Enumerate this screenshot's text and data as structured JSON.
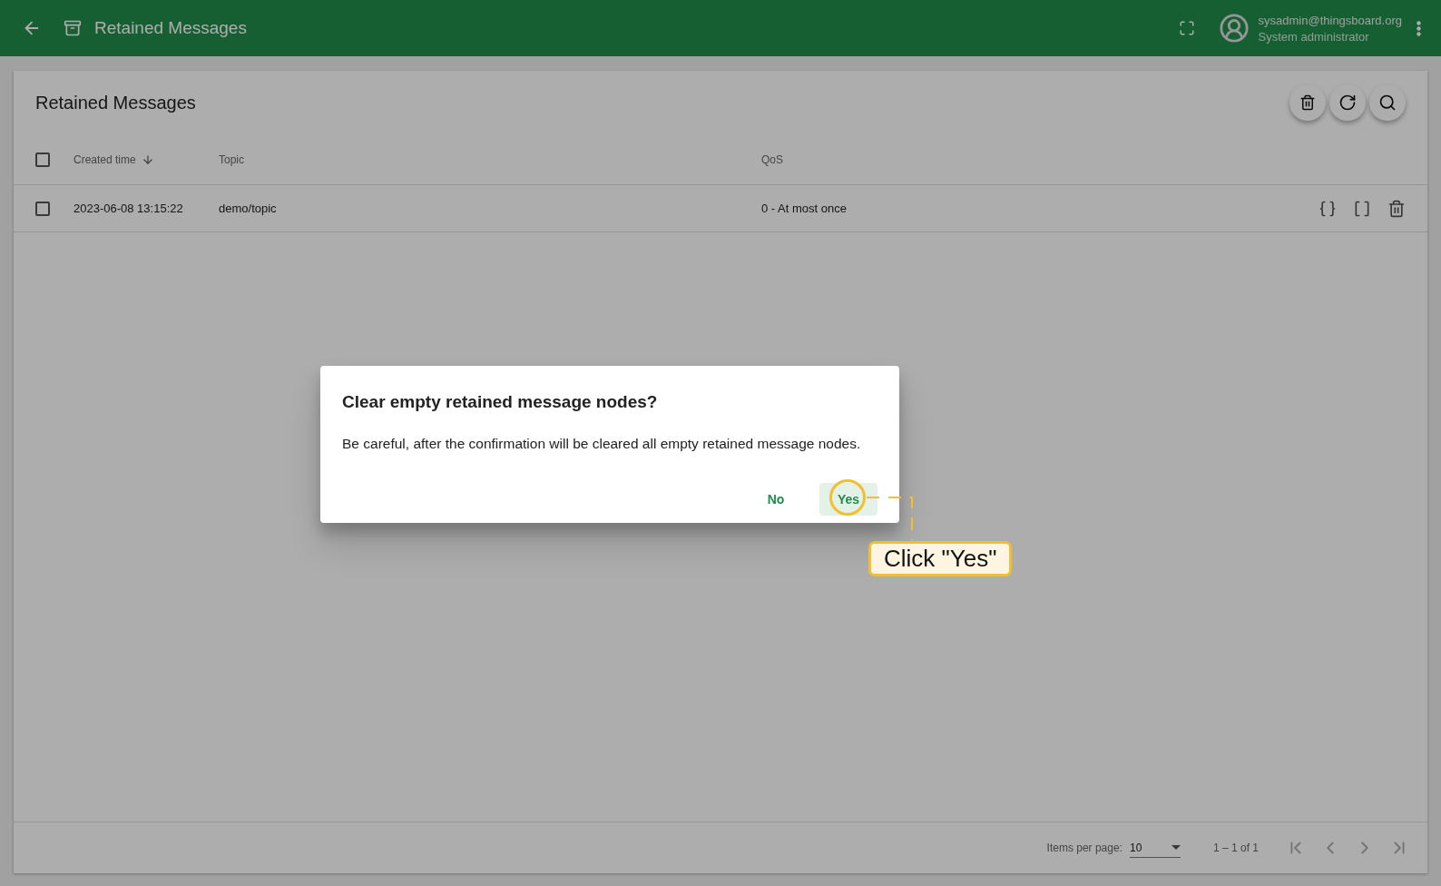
{
  "header": {
    "title": "Retained Messages",
    "user_email": "sysadmin@thingsboard.org",
    "user_role": "System administrator"
  },
  "card": {
    "title": "Retained Messages"
  },
  "table": {
    "select_all_checked": false,
    "columns": [
      {
        "label": "Created time",
        "sorted": true
      },
      {
        "label": "Topic",
        "sorted": false
      },
      {
        "label": "QoS",
        "sorted": false
      }
    ],
    "rows": [
      {
        "checked": false,
        "cells": [
          "2023-06-08 13:15:22",
          "demo/topic",
          "0 - At most once"
        ]
      }
    ]
  },
  "paginator": {
    "label": "Items per page:",
    "page_size": "10",
    "range": "1 – 1 of 1"
  },
  "dialog": {
    "title": "Clear empty retained message nodes?",
    "message": "Be careful, after the confirmation will be cleared all empty retained message nodes.",
    "buttons": [
      {
        "label": "No",
        "highlighted": false
      },
      {
        "label": "Yes",
        "highlighted": true
      }
    ]
  },
  "callout": {
    "text": "Click \"Yes\""
  }
}
